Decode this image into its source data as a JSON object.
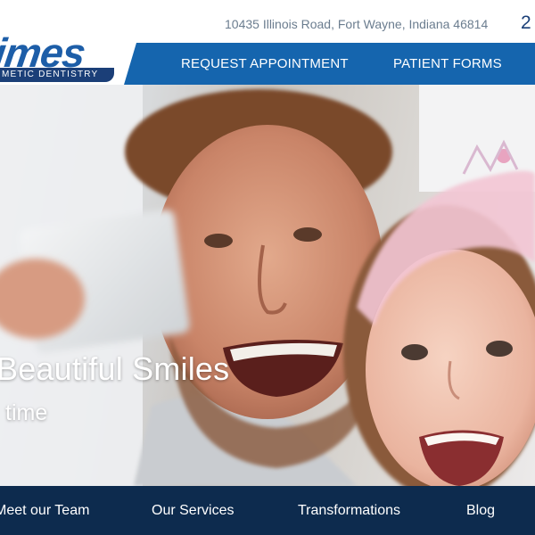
{
  "header": {
    "logo_text": "imes",
    "logo_tagline": "METIC DENTISTRY",
    "address": "10435 Illinois Road, Fort Wayne, Indiana 46814",
    "phone": "2",
    "brand_color": "#1565ae",
    "brand_dark": "#1a3f77"
  },
  "top_nav": {
    "items": [
      {
        "label": "REQUEST APPOINTMENT"
      },
      {
        "label": "PATIENT FORMS"
      }
    ]
  },
  "hero": {
    "title": "Beautiful Smiles",
    "subtitle": "time"
  },
  "bottom_nav": {
    "background": "#0d2b4e",
    "items": [
      {
        "label": "Meet our Team"
      },
      {
        "label": "Our Services"
      },
      {
        "label": "Transformations"
      },
      {
        "label": "Blog"
      }
    ]
  }
}
